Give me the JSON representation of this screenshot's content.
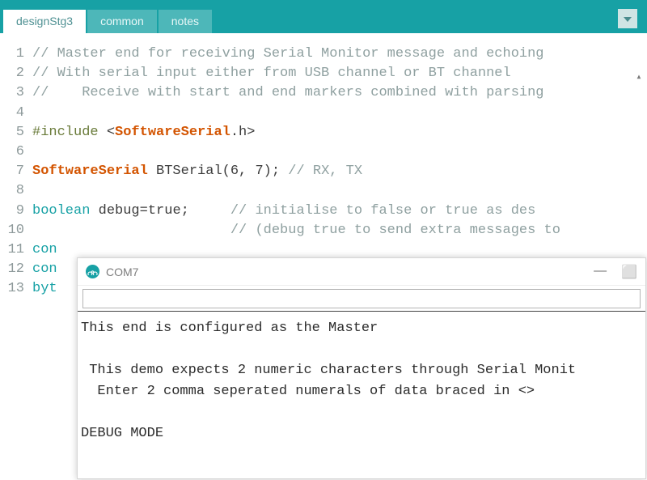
{
  "tabs": [
    {
      "label": "designStg3",
      "active": true
    },
    {
      "label": "common",
      "active": false
    },
    {
      "label": "notes",
      "active": false
    }
  ],
  "code": {
    "lines": [
      {
        "n": 1,
        "segs": [
          {
            "cls": "k-comment",
            "t": "// Master end for receiving Serial Monitor message and echoing"
          }
        ]
      },
      {
        "n": 2,
        "segs": [
          {
            "cls": "k-comment",
            "t": "// With serial input either from USB channel or BT channel"
          }
        ]
      },
      {
        "n": 3,
        "segs": [
          {
            "cls": "k-comment",
            "t": "//    Receive with start and end markers combined with parsing"
          }
        ]
      },
      {
        "n": 4,
        "segs": []
      },
      {
        "n": 5,
        "segs": [
          {
            "cls": "k-preproc",
            "t": "#include "
          },
          {
            "cls": "k-plain",
            "t": "<"
          },
          {
            "cls": "k-type",
            "t": "SoftwareSerial"
          },
          {
            "cls": "k-plain",
            "t": ".h>"
          }
        ]
      },
      {
        "n": 6,
        "segs": []
      },
      {
        "n": 7,
        "segs": [
          {
            "cls": "k-type",
            "t": "SoftwareSerial"
          },
          {
            "cls": "k-plain",
            "t": " BTSerial(6, 7); "
          },
          {
            "cls": "k-comment",
            "t": "// RX, TX"
          }
        ]
      },
      {
        "n": 8,
        "segs": []
      },
      {
        "n": 9,
        "segs": [
          {
            "cls": "k-type2",
            "t": "boolean"
          },
          {
            "cls": "k-plain",
            "t": " debug=true;     "
          },
          {
            "cls": "k-comment",
            "t": "// initialise to false or true as des"
          }
        ]
      },
      {
        "n": 10,
        "segs": [
          {
            "cls": "k-plain",
            "t": "                        "
          },
          {
            "cls": "k-comment",
            "t": "// (debug true to send extra messages to"
          }
        ]
      },
      {
        "n": 11,
        "segs": [
          {
            "cls": "k-type2",
            "t": "con"
          }
        ]
      },
      {
        "n": 12,
        "segs": [
          {
            "cls": "k-type2",
            "t": "con"
          }
        ]
      },
      {
        "n": 13,
        "segs": [
          {
            "cls": "k-type2",
            "t": "byt"
          }
        ]
      }
    ]
  },
  "serial": {
    "title": "COM7",
    "min": "—",
    "max": "⬜",
    "inputValue": "",
    "output": "This end is configured as the Master\n\n This demo expects 2 numeric characters through Serial Monit\n  Enter 2 comma seperated numerals of data braced in <>\n\nDEBUG MODE"
  }
}
